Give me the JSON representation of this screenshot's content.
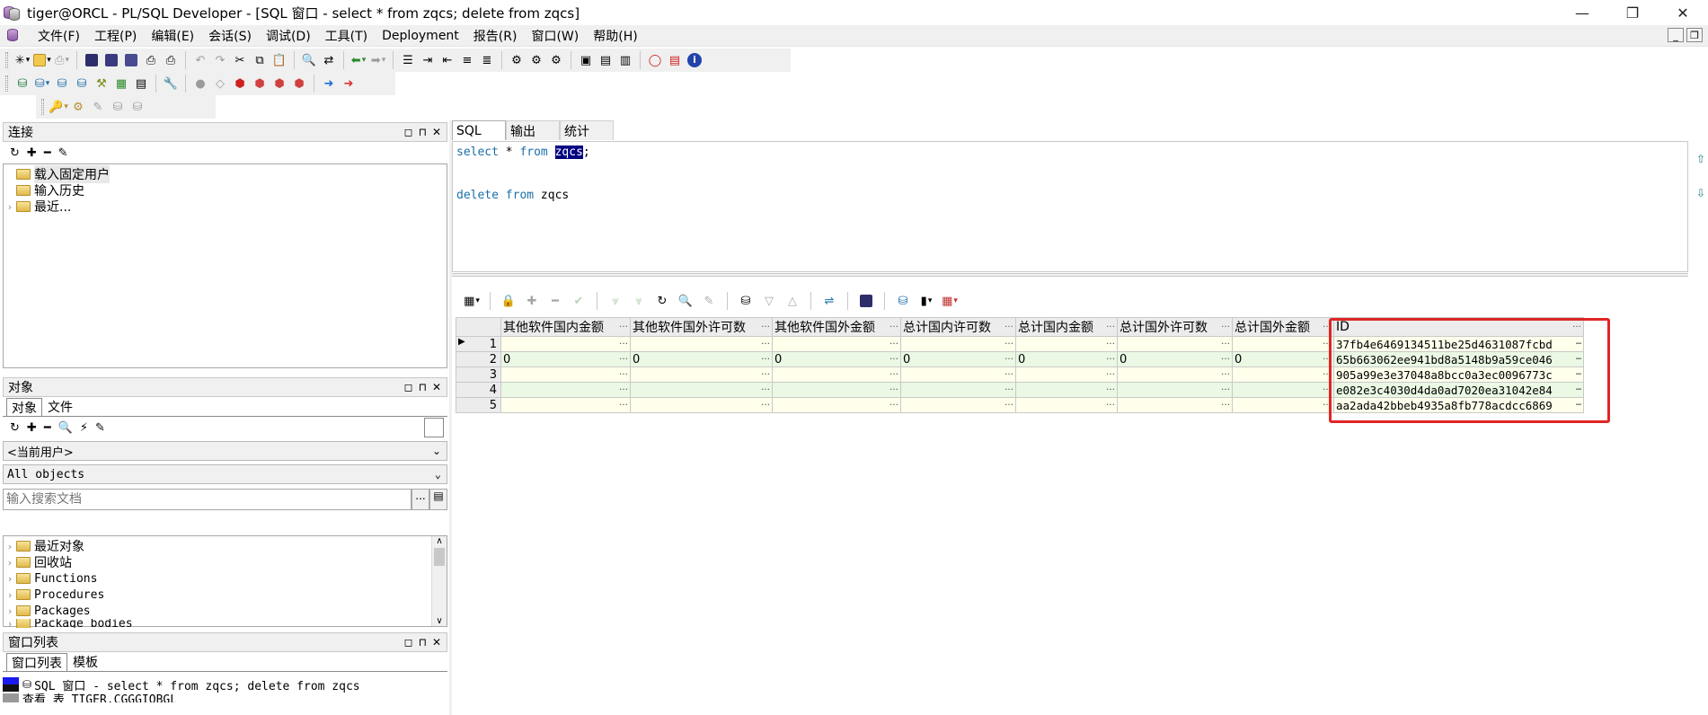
{
  "window": {
    "title": "tiger@ORCL - PL/SQL Developer - [SQL 窗口 - select * from zqcs; delete from zqcs]",
    "minimize": "—",
    "maximize": "❐",
    "close": "✕"
  },
  "menu": {
    "items": [
      "文件(F)",
      "工程(P)",
      "编辑(E)",
      "会话(S)",
      "调试(D)",
      "工具(T)",
      "Deployment",
      "报告(R)",
      "窗口(W)",
      "帮助(H)"
    ],
    "mdi": [
      "_",
      "❐",
      "×"
    ]
  },
  "connection_panel": {
    "title": "连接",
    "tree": [
      {
        "label": "载入固定用户",
        "selected": true,
        "expander": ""
      },
      {
        "label": "输入历史",
        "selected": false,
        "expander": ""
      },
      {
        "label": "最近...",
        "selected": false,
        "expander": "›"
      }
    ]
  },
  "objects_panel": {
    "title": "对象",
    "tabs": [
      "对象",
      "文件"
    ],
    "user_dropdown": "<当前用户>",
    "filter_dropdown": "All objects",
    "search_placeholder": "输入搜索文档",
    "search_more": "...",
    "tree": [
      "最近对象",
      "回收站",
      "Functions",
      "Procedures",
      "Packages",
      "Package bodies"
    ]
  },
  "window_list_panel": {
    "title": "窗口列表",
    "tabs": [
      "窗口列表",
      "模板"
    ],
    "items": [
      "SQL 窗口 - select * from zqcs; delete from zqcs",
      "查看 表 TIGER.CGGGIOBGL"
    ]
  },
  "sql_tabs": [
    "SQL",
    "输出",
    "统计"
  ],
  "editor": {
    "line1_kw1": "select",
    "line1_mid": " * ",
    "line1_kw2": "from",
    "line1_sp": " ",
    "line1_sel": "zqcs",
    "line1_end": ";",
    "line2_kw": "delete from",
    "line2_rest": " zqcs"
  },
  "grid": {
    "columns": [
      "其他软件国内金额",
      "其他软件国外许可数",
      "其他软件国外金额",
      "总计国内许可数",
      "总计国内金额",
      "总计国外许可数",
      "总计国外金额",
      "ID"
    ],
    "rows": [
      {
        "n": "1",
        "values": [
          "",
          "",
          "",
          "",
          "",
          "",
          "",
          "37fb4e6469134511be25d4631087fcbd"
        ]
      },
      {
        "n": "2",
        "values": [
          "0",
          "0",
          "0",
          "0",
          "0",
          "0",
          "0",
          "65b663062ee941bd8a5148b9a59ce046"
        ]
      },
      {
        "n": "3",
        "values": [
          "",
          "",
          "",
          "",
          "",
          "",
          "",
          "905a99e3e37048a8bcc0a3ec0096773c"
        ]
      },
      {
        "n": "4",
        "values": [
          "",
          "",
          "",
          "",
          "",
          "",
          "",
          "e082e3c4030d4da0ad7020ea31042e84"
        ]
      },
      {
        "n": "5",
        "values": [
          "",
          "",
          "",
          "",
          "",
          "",
          "",
          "aa2ada42bbeb4935a8fb778acdcc6869"
        ]
      }
    ],
    "current_row_marker": "▶"
  },
  "colors": {
    "highlight_box": "#e02525",
    "keyword": "#1a6fa8",
    "selection": "#000080",
    "row_odd": "#ffffec",
    "row_even": "#eaf8e4"
  }
}
